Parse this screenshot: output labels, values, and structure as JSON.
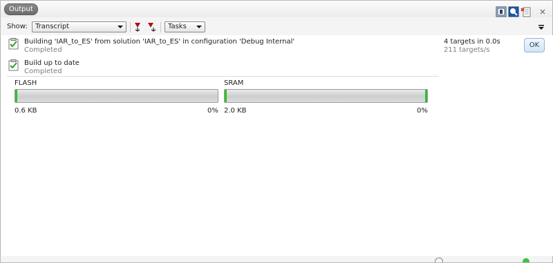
{
  "panel": {
    "title": "Output"
  },
  "toolbar": {
    "show_label": "Show:",
    "show_value": "Transcript",
    "tasks_value": "Tasks"
  },
  "messages": [
    {
      "text": "Building 'IAR_to_ES' from solution 'IAR_to_ES' in configuration 'Debug Internal'",
      "status": "Completed"
    },
    {
      "text": "Build up to date",
      "status": "Completed"
    }
  ],
  "summary": {
    "targets": "4 targets in 0.0s",
    "rate": "211 targets/s"
  },
  "ok_label": "OK",
  "memory": [
    {
      "name": "FLASH",
      "size": "0.6 KB",
      "percent": "0%",
      "usage_fraction": 0.0
    },
    {
      "name": "SRAM",
      "size": "2.0 KB",
      "percent": "0%",
      "usage_fraction": 0.0
    }
  ],
  "colors": {
    "bar_fill": "#2fbf2f",
    "title_pill": "#6c6c6c",
    "ok_button": "#d3e4f6"
  },
  "icons": [
    "checklist-icon",
    "pin-panel-icon",
    "search-panel-icon",
    "clear-output-icon",
    "close-icon",
    "menu-down-icon",
    "prev-error-icon",
    "next-error-icon"
  ]
}
